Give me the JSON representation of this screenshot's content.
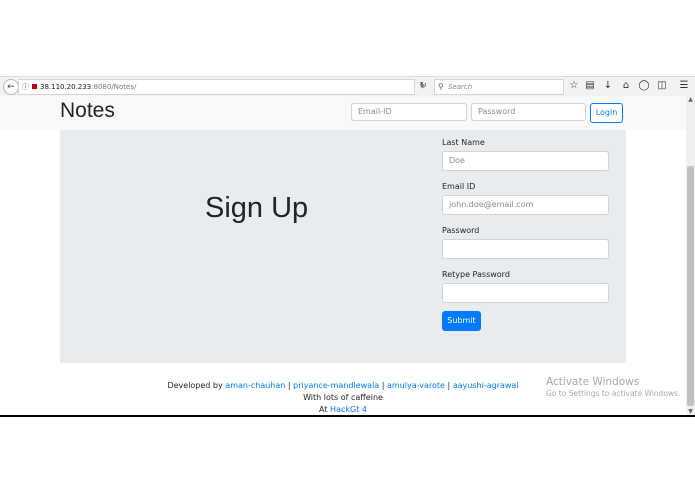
{
  "browser": {
    "back_icon": "back-arrow-icon",
    "url_host": "38.110.20.233",
    "url_path": ":8080/Notes/",
    "search_placeholder": "Search",
    "toolbar_icons": [
      "star-icon",
      "clipboard-icon",
      "download-icon",
      "home-icon",
      "pocket-icon",
      "reader-icon",
      "menu-icon"
    ]
  },
  "navbar": {
    "brand": "Notes",
    "email_placeholder": "Email-ID",
    "password_placeholder": "Password",
    "login_label": "Login"
  },
  "signup": {
    "title": "Sign Up",
    "last_name_label": "Last Name",
    "last_name_placeholder": "Doe",
    "email_label": "Email ID",
    "email_placeholder": "john.doe@email.com",
    "password_label": "Password",
    "retype_label": "Retype Password",
    "submit_label": "Submit"
  },
  "footer": {
    "developed_by": "Developed by ",
    "devs": [
      "aman-chauhan",
      "priyance-mandlewala",
      "amulya-varote",
      "aayushi-agrawal"
    ],
    "separator": " | ",
    "line2": "With lots of caffeine",
    "line3_prefix": "At ",
    "line3_link": "HackGt 4"
  },
  "watermark": {
    "line1": "Activate Windows",
    "line2": "Go to Settings to activate Windows."
  },
  "colors": {
    "accent": "#007bff",
    "panel": "#e9ecef",
    "navbar": "#f8f9fa"
  }
}
